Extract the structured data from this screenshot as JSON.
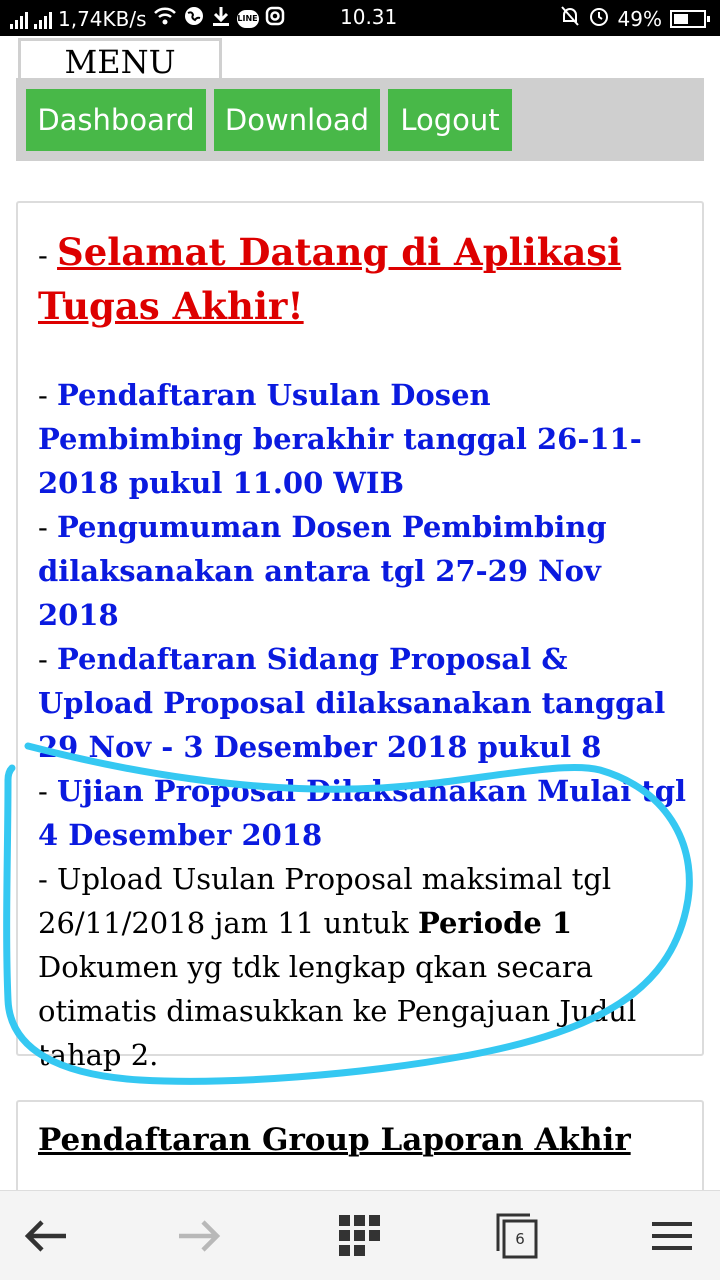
{
  "status_bar": {
    "speed": "1,74KB/s",
    "time": "10.31",
    "battery": "49%",
    "icons": [
      "signal-icon",
      "wifi-icon",
      "globe-icon",
      "download-icon",
      "line-icon",
      "instagram-icon",
      "mute-icon",
      "alarm-icon",
      "battery-icon"
    ]
  },
  "menu": {
    "title": "MENU",
    "buttons": [
      "Dashboard",
      "Download",
      "Logout"
    ],
    "button_color": "#48b848"
  },
  "announcement": {
    "welcome_prefix": "- ",
    "welcome": "Selamat Datang di Aplikasi Tugas Akhir!",
    "items": [
      {
        "prefix": "- ",
        "text": "Pendaftaran Usulan Dosen Pembimbing berakhir tanggal 26-11-2018 pukul 11.00 WIB"
      },
      {
        "prefix": "- ",
        "text": "Pengumuman Dosen Pembimbing dilaksanakan antara tgl 27-29 Nov 2018"
      },
      {
        "prefix": "- ",
        "text": "Pendaftaran Sidang Proposal & Upload Proposal dilaksanakan tanggal 29 Nov - 3 Desember 2018 pukul 8"
      },
      {
        "prefix": "- ",
        "text": "Ujian Proposal Dilaksanakan Mulai tgl 4 Desember 2018"
      }
    ],
    "note_prefix": "- Upload Usulan Proposal maksimal tgl 26/11/2018 jam 11 untuk ",
    "note_bold": "Periode 1",
    "note_rest": "Dokumen yg tdk lengkap qkan secara otimatis dimasukkan ke Pengajuan Judul tahap 2.",
    "welcome_color": "#dd0000",
    "item_color": "#0a1adf"
  },
  "group_section": {
    "title": "Pendaftaran Group Laporan Akhir"
  },
  "bottom_bar": {
    "tab_count": "6",
    "icons": [
      "back-arrow-icon",
      "forward-arrow-icon",
      "grid-icon",
      "tabs-icon",
      "hamburger-menu-icon"
    ]
  },
  "annotation_color": "#35c8f2"
}
